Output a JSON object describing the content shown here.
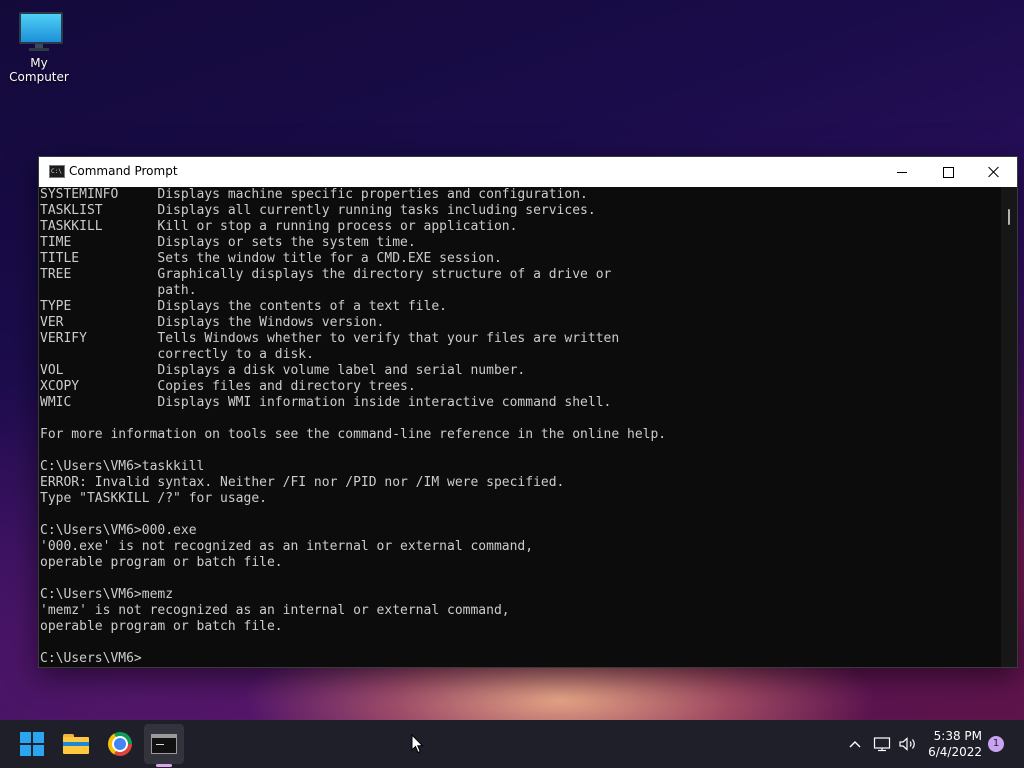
{
  "desktop": {
    "icons": [
      {
        "label": "My Computer",
        "icon": "monitor-icon"
      }
    ]
  },
  "window": {
    "title": "Command Prompt",
    "icon": "cmd-icon",
    "controls": {
      "minimize": "minimize-icon",
      "maximize": "maximize-icon",
      "close": "close-icon"
    },
    "console_lines": [
      "SYSTEMINFO     Displays machine specific properties and configuration.",
      "TASKLIST       Displays all currently running tasks including services.",
      "TASKKILL       Kill or stop a running process or application.",
      "TIME           Displays or sets the system time.",
      "TITLE          Sets the window title for a CMD.EXE session.",
      "TREE           Graphically displays the directory structure of a drive or",
      "               path.",
      "TYPE           Displays the contents of a text file.",
      "VER            Displays the Windows version.",
      "VERIFY         Tells Windows whether to verify that your files are written",
      "               correctly to a disk.",
      "VOL            Displays a disk volume label and serial number.",
      "XCOPY          Copies files and directory trees.",
      "WMIC           Displays WMI information inside interactive command shell.",
      "",
      "For more information on tools see the command-line reference in the online help.",
      "",
      "C:\\Users\\VM6>taskkill",
      "ERROR: Invalid syntax. Neither /FI nor /PID nor /IM were specified.",
      "Type \"TASKKILL /?\" for usage.",
      "",
      "C:\\Users\\VM6>000.exe",
      "'000.exe' is not recognized as an internal or external command,",
      "operable program or batch file.",
      "",
      "C:\\Users\\VM6>memz",
      "'memz' is not recognized as an internal or external command,",
      "operable program or batch file.",
      "",
      "C:\\Users\\VM6>"
    ]
  },
  "taskbar": {
    "pinned": [
      {
        "name": "start",
        "icon": "windows-logo-icon"
      },
      {
        "name": "file-explorer",
        "icon": "folder-icon"
      },
      {
        "name": "chrome",
        "icon": "chrome-icon"
      },
      {
        "name": "command-prompt",
        "icon": "cmd-icon",
        "active": true
      }
    ],
    "tray": {
      "overflow_icon": "chevron-up-icon",
      "network_icon": "network-icon",
      "volume_icon": "volume-icon",
      "time": "5:38 PM",
      "date": "6/4/2022",
      "notification_count": "1"
    }
  }
}
